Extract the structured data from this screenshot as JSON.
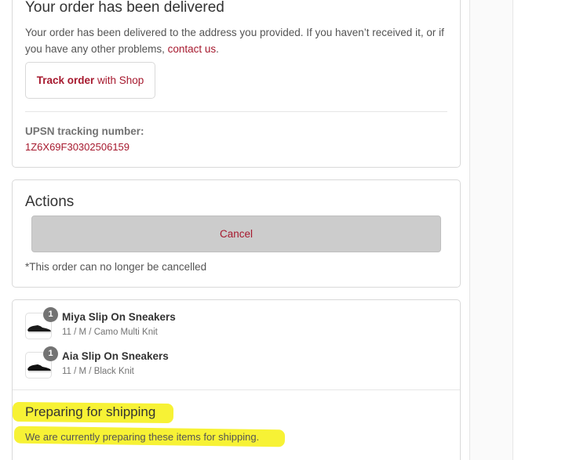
{
  "delivered_card": {
    "title": "Your order has been delivered",
    "text_before_link": "Your order has been delivered to the address you provided. If you haven’t received it, or if you have any other problems, ",
    "contact_link": "contact us",
    "text_after_link": ".",
    "track_button_strong": "Track order",
    "track_button_light": " with Shop",
    "tracking_label": "UPSN tracking number:",
    "tracking_number": "1Z6X69F30302506159"
  },
  "actions_card": {
    "title": "Actions",
    "cancel_button": "Cancel",
    "note": "*This order can no longer be cancelled"
  },
  "items_card": {
    "items": [
      {
        "name": "Miya Slip On Sneakers",
        "variant": "11 / M / Camo Multi Knit",
        "quantity": "1",
        "icon": "sneaker-icon"
      },
      {
        "name": "Aia Slip On Sneakers",
        "variant": "11 / M / Black Knit",
        "quantity": "1",
        "icon": "sneaker-icon"
      }
    ],
    "status_title": "Preparing for shipping",
    "status_text": "We are currently preparing these items for shipping.",
    "highlight_color": "#f7f235"
  },
  "colors": {
    "accent": "#a6192e",
    "border": "#d9d9d9",
    "cancel_bg": "#cccccc"
  }
}
